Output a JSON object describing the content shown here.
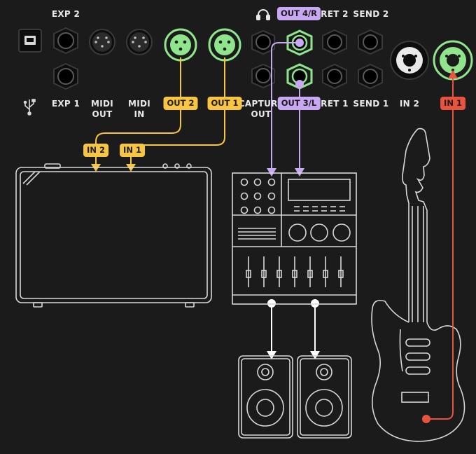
{
  "labels": {
    "exp2": "EXP 2",
    "exp1": "EXP 1",
    "midi_out": "MIDI\nOUT",
    "midi_in": "MIDI\nIN",
    "capture_out": "CAPTURE\nOUT",
    "ret2": "RET 2",
    "send2": "SEND 2",
    "ret1": "RET 1",
    "send1": "SEND 1",
    "in2": "IN 2"
  },
  "tags": {
    "out2": "OUT 2",
    "out1": "OUT 1",
    "out4r": "OUT 4/R",
    "out3l": "OUT 3/L",
    "in1_device": "IN 1",
    "amp_in2": "IN 2",
    "amp_in1": "IN 1"
  },
  "colors": {
    "background": "#1b1b1b",
    "yellow": "#f7c542",
    "purple": "#c8a7f3",
    "red": "#e8533f",
    "green": "#8ee58c",
    "white": "#ffffff",
    "outline": "#d8d8d8"
  },
  "icons": [
    "usb-icon",
    "headphones-icon"
  ]
}
